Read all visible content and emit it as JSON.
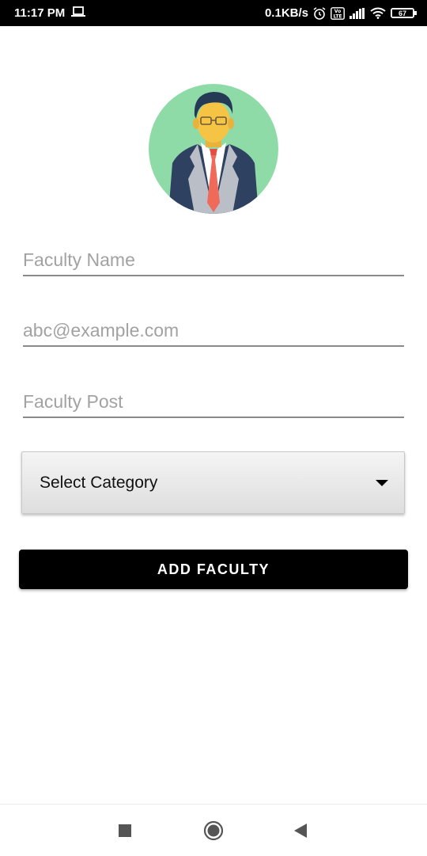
{
  "status_bar": {
    "time": "11:17 PM",
    "network_speed": "0.1KB/s",
    "battery_level": "67",
    "icons": [
      "laptop-icon",
      "alarm-icon",
      "volte-icon",
      "signal-icon",
      "wifi-icon",
      "battery-icon"
    ]
  },
  "form": {
    "avatar_icon": "businessman-avatar-icon",
    "faculty_name_placeholder": "Faculty Name",
    "email_placeholder": "abc@example.com",
    "faculty_post_placeholder": "Faculty Post",
    "category_select_label": "Select Category",
    "submit_label": "ADD FACULTY"
  },
  "nav_bar": {
    "icons": [
      "recents-square-icon",
      "home-circle-icon",
      "back-triangle-icon"
    ]
  },
  "colors": {
    "status_bar_bg": "#000000",
    "avatar_bg": "#8fdba8",
    "button_bg": "#000000",
    "underline": "#8a8a8a"
  }
}
